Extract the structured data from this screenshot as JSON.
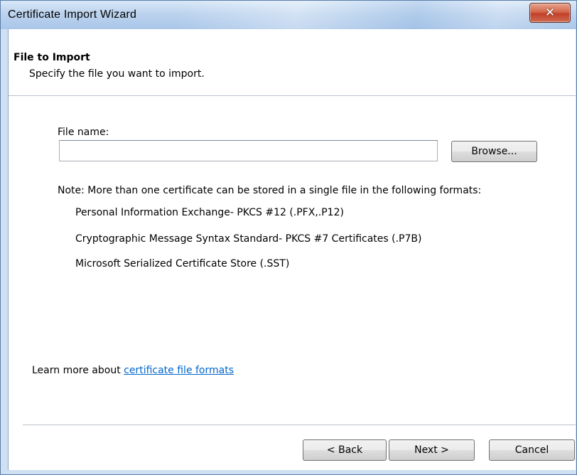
{
  "window": {
    "title": "Certificate Import Wizard",
    "close_symbol": "✕"
  },
  "page": {
    "heading": "File to Import",
    "subheading": "Specify the file you want to import."
  },
  "file": {
    "label": "File name:",
    "value": "",
    "browse_label": "Browse..."
  },
  "note": {
    "text": "Note:  More than one certificate can be stored in a single file in the following formats:",
    "formats": [
      "Personal Information Exchange- PKCS #12 (.PFX,.P12)",
      "Cryptographic Message Syntax Standard- PKCS #7 Certificates (.P7B)",
      "Microsoft Serialized Certificate Store (.SST)"
    ]
  },
  "learn_more": {
    "prefix": "Learn more about ",
    "link_text": "certificate file formats"
  },
  "footer": {
    "back_label": "< Back",
    "next_label": "Next >",
    "cancel_label": "Cancel"
  },
  "colors": {
    "link": "#0066cc",
    "close_button": "#c2412a",
    "titlebar": "#bcd3ee"
  },
  "icons": {
    "close": "close-icon"
  }
}
